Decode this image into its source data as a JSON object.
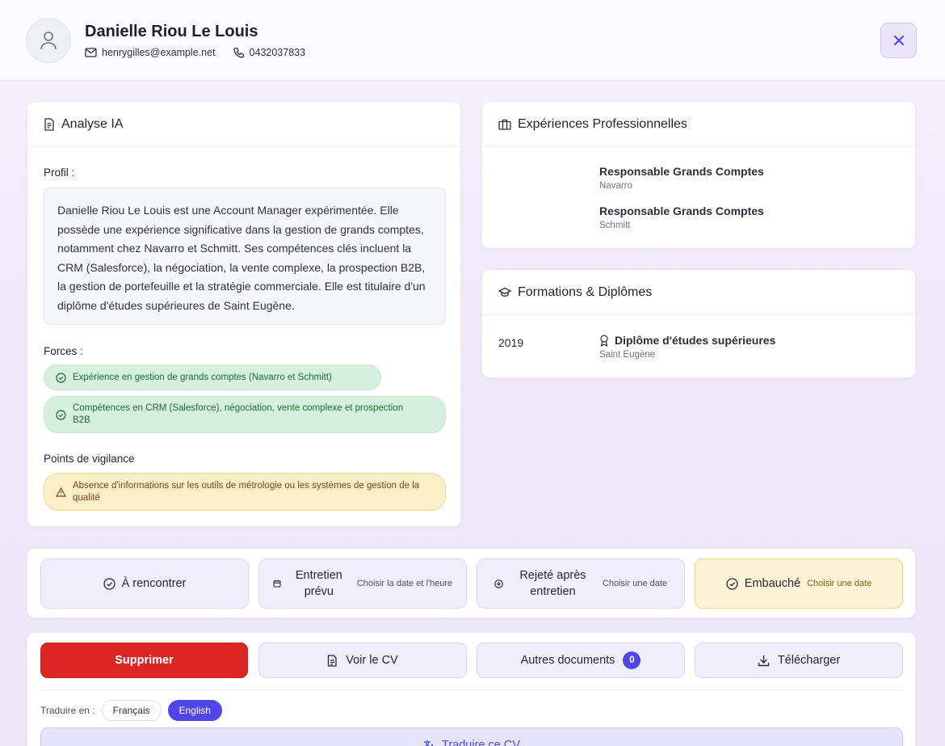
{
  "candidate": {
    "name": "Danielle Riou Le Louis",
    "email": "henrygilles@example.net",
    "phone": "0432037833"
  },
  "analysis": {
    "title": "Analyse IA",
    "profile_label": "Profil :",
    "profile_text": "Danielle Riou Le Louis est une Account Manager expérimentée. Elle possède une expérience significative dans la gestion de grands comptes, notamment chez Navarro et Schmitt. Ses compétences clés incluent la CRM (Salesforce), la négociation, la vente complexe, la prospection B2B, la gestion de portefeuille et la stratégie commerciale. Elle est titulaire d'un diplôme d'études supérieures de Saint Eugène.",
    "strengths_label": "Forces :",
    "strengths": [
      "Expérience en gestion de grands comptes (Navarro et Schmitt)",
      "Compétences en CRM (Salesforce), négociation, vente complexe et prospection B2B"
    ],
    "warnings_label": "Points de vigilance",
    "warnings": [
      "Absence d'informations sur les outils de métrologie ou les systèmes de gestion de la qualité"
    ]
  },
  "experience": {
    "title": "Expériences Professionnelles",
    "items": [
      {
        "role": "Responsable Grands Comptes",
        "company": "Navarro"
      },
      {
        "role": "Responsable Grands Comptes",
        "company": "Schmitt"
      }
    ]
  },
  "education": {
    "title": "Formations & Diplômes",
    "items": [
      {
        "year": "2019",
        "degree": "Diplôme d'études supérieures",
        "school": "Saint Eugène"
      }
    ]
  },
  "statuses": [
    {
      "label": "À rencontrer",
      "hint": ""
    },
    {
      "label": "Entretien prévu",
      "hint": "Choisir la date et l'heure"
    },
    {
      "label": "Rejeté après entretien",
      "hint": "Choisir une date"
    },
    {
      "label": "Embauché",
      "hint": "Choisir une date"
    }
  ],
  "actions": {
    "delete": "Supprimer",
    "view_cv": "Voir le CV",
    "other_docs": "Autres documents",
    "other_docs_count": "0",
    "download": "Télécharger"
  },
  "translate": {
    "label": "Traduire en :",
    "languages": [
      "Français",
      "English"
    ],
    "selected": "English",
    "button": "Traduire ce CV"
  },
  "colors": {
    "accent": "#4f46e5",
    "danger": "#dc2626",
    "success_bg": "#d7f0dd",
    "warning_bg": "#fdf0c9",
    "hired_bg": "#fdf4d7"
  }
}
